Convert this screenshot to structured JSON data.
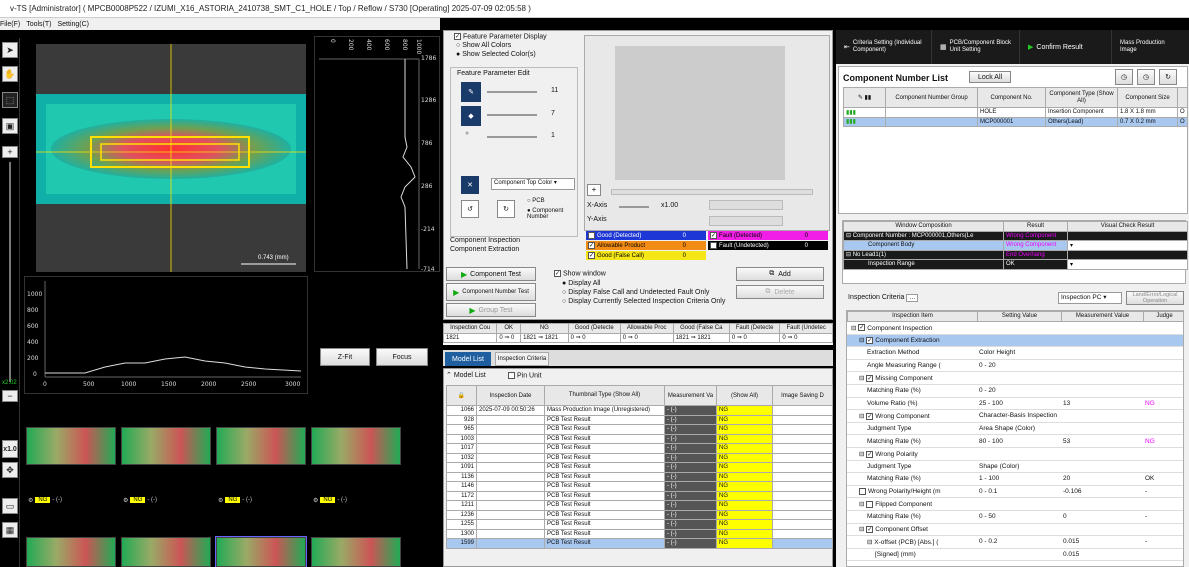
{
  "title": "v-TS [Administrator] ( MPCB0008P522 / IZUMI_X16_ASTORIA_2410738_SMT_C1_HOLE / Top / Reflow / S730 [Operating] 2025-07-09 02:05:58 )",
  "menu": [
    "File(F)",
    "Tools(T)",
    "Setting(C)"
  ],
  "zoom": "x2.02",
  "zoom_btn": "x1.0",
  "heat_scale": "0.743 (mm)",
  "vgraph": {
    "top_ticks": [
      "0",
      "200",
      "400",
      "600",
      "800",
      "1000"
    ],
    "right_ticks": [
      "1786",
      "1286",
      "786",
      "286",
      "-214",
      "-714"
    ]
  },
  "hgraph": {
    "left_ticks": [
      "1000",
      "800",
      "600",
      "400",
      "200",
      "0"
    ],
    "bottom_ticks": [
      "0",
      "500",
      "1000",
      "1500",
      "2000",
      "2500",
      "3000"
    ]
  },
  "zfit": "Z-Fit",
  "focus": "Focus",
  "thumbs": {
    "ng": "NG",
    "val": "- (-)"
  },
  "feature": {
    "display_label": "Feature Parameter Display",
    "show_all": "Show All Colors",
    "show_selected": "Show Selected Color(s)",
    "edit_label": "Feature Parameter Edit",
    "v1": "11",
    "v2": "7",
    "v3": "1",
    "top_color": "Component Top Color",
    "pcb": "PCB",
    "comp_number": "Component Number"
  },
  "xaxis": "X-Axis",
  "yaxis": "Y-Axis",
  "zoomval": "x1.00",
  "comp_insp": "Component Inspection",
  "comp_extr": "Component Extraction",
  "legend": {
    "good_det": "Good (Detected)",
    "good_det_v": "0",
    "allow": "Allowable Product",
    "allow_v": "0",
    "good_false": "Good (False Call)",
    "good_false_v": "0",
    "fault_det": "Fault (Detected)",
    "fault_det_v": "0",
    "fault_undet": "Fault (Undetected)",
    "fault_undet_v": "0",
    "colors": {
      "good": "#1c37d6",
      "allow": "#f28c14",
      "false": "#f5e617",
      "fault": "#f01ee6",
      "undet": "#000000"
    }
  },
  "btns": {
    "comp_test": "Component Test",
    "comp_num_test": "Component Number Test",
    "group_test": "Group Test",
    "show_window": "Show window",
    "display_all": "Display All",
    "display_false": "Display False Call and Undetected Fault Only",
    "display_current": "Display Currently Selected Inspection Criteria Only",
    "add": "Add",
    "delete": "Delete"
  },
  "stats": {
    "headers": [
      "Inspection Cou",
      "OK",
      "NG",
      "Good (Detecte",
      "Allowable Proc",
      "Good (False Ca",
      "Fault (Detecte",
      "Fault (Undetec"
    ],
    "values": [
      "1821",
      "0 ⇒ 0",
      "1821 ⇒ 1821",
      "0 ⇒ 0",
      "0 ⇒ 0",
      "1821 ⇒ 1821",
      "0 ⇒ 0",
      "0 ⇒ 0"
    ]
  },
  "tabs": {
    "model_list": "Model List",
    "insp_criteria": "Inspection Criteria"
  },
  "modellist": {
    "title": "Model List",
    "pin_unit": "Pin Unit",
    "headers": [
      "Inspection Date",
      "Thumbnail Type (Show All)",
      "Measurement Va",
      "(Show All)",
      "Image Saving D"
    ],
    "rows": [
      {
        "id": "1066",
        "date": "2025-07-09 00:50:26",
        "type": "Mass Production Image (Unregistered)",
        "mv": "- (-)",
        "res": "NG"
      },
      {
        "id": "928",
        "date": "",
        "type": "PCB Test Result",
        "mv": "- (-)",
        "res": "NG"
      },
      {
        "id": "965",
        "date": "",
        "type": "PCB Test Result",
        "mv": "- (-)",
        "res": "NG"
      },
      {
        "id": "1003",
        "date": "",
        "type": "PCB Test Result",
        "mv": "- (-)",
        "res": "NG"
      },
      {
        "id": "1017",
        "date": "",
        "type": "PCB Test Result",
        "mv": "- (-)",
        "res": "NG"
      },
      {
        "id": "1032",
        "date": "",
        "type": "PCB Test Result",
        "mv": "- (-)",
        "res": "NG"
      },
      {
        "id": "1091",
        "date": "",
        "type": "PCB Test Result",
        "mv": "- (-)",
        "res": "NG"
      },
      {
        "id": "1136",
        "date": "",
        "type": "PCB Test Result",
        "mv": "- (-)",
        "res": "NG"
      },
      {
        "id": "1146",
        "date": "",
        "type": "PCB Test Result",
        "mv": "- (-)",
        "res": "NG"
      },
      {
        "id": "1172",
        "date": "",
        "type": "PCB Test Result",
        "mv": "- (-)",
        "res": "NG"
      },
      {
        "id": "1211",
        "date": "",
        "type": "PCB Test Result",
        "mv": "- (-)",
        "res": "NG"
      },
      {
        "id": "1236",
        "date": "",
        "type": "PCB Test Result",
        "mv": "- (-)",
        "res": "NG"
      },
      {
        "id": "1255",
        "date": "",
        "type": "PCB Test Result",
        "mv": "- (-)",
        "res": "NG"
      },
      {
        "id": "1300",
        "date": "",
        "type": "PCB Test Result",
        "mv": "- (-)",
        "res": "NG"
      },
      {
        "id": "1599",
        "date": "",
        "type": "PCB Test Result",
        "mv": "- (-)",
        "res": "NG"
      }
    ]
  },
  "rtool": {
    "criteria": "Criteria Setting (Individual Component)",
    "block": "PCB/Component Block Unit Setting",
    "confirm": "Confirm Result",
    "mass": "Mass Production Image"
  },
  "cnl": {
    "title": "Component Number List",
    "lock_all": "Lock All",
    "headers": [
      "Component Number Group",
      "Component No.",
      "Component Type (Show All)",
      "Component Size"
    ],
    "rows": [
      {
        "group": "",
        "no": "HOLE",
        "type": "Insertion Component",
        "size": "1.8 X 1.8 mm",
        "x": "O"
      },
      {
        "group": "",
        "no": "MCP000001",
        "type": "Others(Lead)",
        "size": "0.7 X 0.2 mm",
        "x": "O"
      }
    ]
  },
  "wc": {
    "headers": [
      "Window Composition",
      "Result",
      "Visual Check Result"
    ],
    "rows": [
      {
        "name": "Component Number : MCP000001,Others(Le",
        "result": "Wrong Component"
      },
      {
        "name": "Component Body",
        "result": "Wrong Component"
      },
      {
        "name": "No Lead1(1)",
        "result": "End Overhang"
      },
      {
        "name": "Inspection Range",
        "result": "OK"
      }
    ]
  },
  "ic": {
    "title": "Inspection Criteria",
    "mode": "Inspection PC",
    "land": "Land/Error/Logical Operation",
    "headers": [
      "Inspection Item",
      "Setting Value",
      "Measurement Value",
      "Judge"
    ],
    "rows": [
      {
        "item": "Component Inspection",
        "set": "",
        "mv": "",
        "j": ""
      },
      {
        "item": "Component Extraction",
        "set": "",
        "mv": "",
        "j": ""
      },
      {
        "item": "Extraction Method",
        "set": "Color  Height",
        "mv": "",
        "j": ""
      },
      {
        "item": "Angle Measuring Range (",
        "set": "0 - 20",
        "mv": "",
        "j": ""
      },
      {
        "item": "Missing Component",
        "set": "",
        "mv": "",
        "j": ""
      },
      {
        "item": "Matching Rate (%)",
        "set": "0 - 20",
        "mv": "",
        "j": ""
      },
      {
        "item": "Volume Ratio (%)",
        "set": "25 - 100",
        "mv": "13",
        "j": "NG"
      },
      {
        "item": "Wrong Component",
        "set": "Character-Basis Inspection",
        "mv": "",
        "j": ""
      },
      {
        "item": "Judgment Type",
        "set": "Area  Shape (Color)",
        "mv": "",
        "j": ""
      },
      {
        "item": "Matching Rate (%)",
        "set": "80 - 100",
        "mv": "53",
        "j": "NG"
      },
      {
        "item": "Wrong Polarity",
        "set": "",
        "mv": "",
        "j": ""
      },
      {
        "item": "Judgment Type",
        "set": "Shape (Color)",
        "mv": "",
        "j": ""
      },
      {
        "item": "Matching Rate (%)",
        "set": "1 - 100",
        "mv": "20",
        "j": "OK"
      },
      {
        "item": "Wrong Polarity/Height (m",
        "set": "0 - 0.1",
        "mv": "-0.106",
        "j": "-"
      },
      {
        "item": "Flipped Component",
        "set": "",
        "mv": "",
        "j": ""
      },
      {
        "item": "Matching Rate (%)",
        "set": "0 - 50",
        "mv": "0",
        "j": "-"
      },
      {
        "item": "Component Offset",
        "set": "",
        "mv": "",
        "j": ""
      },
      {
        "item": "X-offset (PCB) [Abs.] (",
        "set": "0 - 0.2",
        "mv": "0.015",
        "j": "-"
      },
      {
        "item": "[Signed] (mm)",
        "set": "",
        "mv": "0.015",
        "j": ""
      }
    ]
  }
}
